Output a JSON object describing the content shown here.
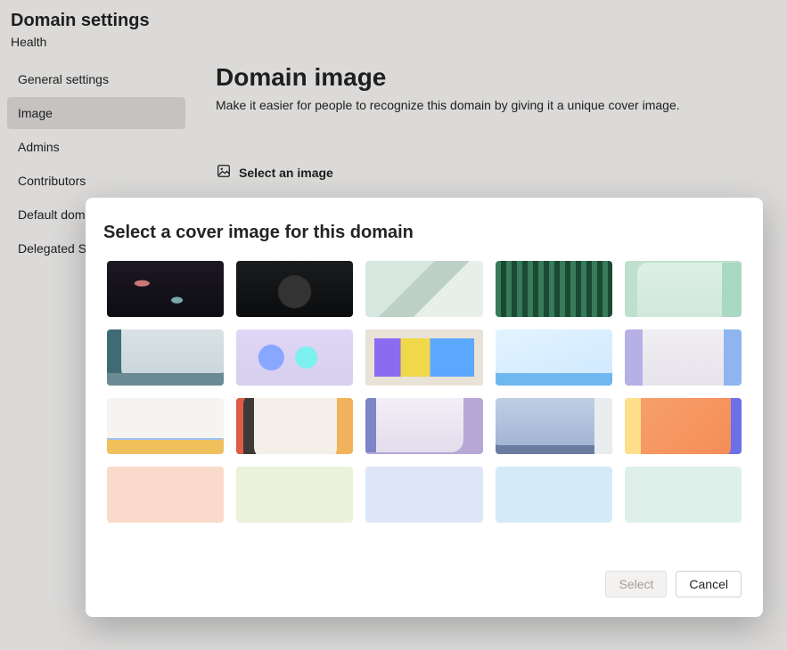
{
  "header": {
    "title": "Domain settings",
    "subtitle": "Health"
  },
  "sidebar": {
    "items": [
      {
        "label": "General settings"
      },
      {
        "label": "Image"
      },
      {
        "label": "Admins"
      },
      {
        "label": "Contributors"
      },
      {
        "label": "Default domain"
      },
      {
        "label": "Delegated Settings"
      }
    ],
    "active_index": 1
  },
  "content": {
    "title": "Domain image",
    "description": "Make it easier for people to recognize this domain by giving it a unique cover image.",
    "select_image_label": "Select an image"
  },
  "dialog": {
    "title": "Select a cover image for this domain",
    "thumbnails": [
      {
        "kind": "image",
        "name": "code-editor-dark"
      },
      {
        "kind": "image",
        "name": "device-dark"
      },
      {
        "kind": "image",
        "name": "abstract-green-tiles"
      },
      {
        "kind": "image",
        "name": "spreadsheet-dark"
      },
      {
        "kind": "image",
        "name": "notebook-mint"
      },
      {
        "kind": "image",
        "name": "teal-cubes"
      },
      {
        "kind": "image",
        "name": "glass-cubes"
      },
      {
        "kind": "image",
        "name": "phone-apps"
      },
      {
        "kind": "image",
        "name": "card-stack-blue"
      },
      {
        "kind": "image",
        "name": "abstract-lavender-shapes"
      },
      {
        "kind": "image",
        "name": "paper-stack-colors"
      },
      {
        "kind": "image",
        "name": "desk-monitor"
      },
      {
        "kind": "image",
        "name": "laptop-pastel"
      },
      {
        "kind": "image",
        "name": "abstract-landscape"
      },
      {
        "kind": "image",
        "name": "orange-render"
      },
      {
        "kind": "swatch",
        "color": "#fadacb"
      },
      {
        "kind": "swatch",
        "color": "#eaf2da"
      },
      {
        "kind": "swatch",
        "color": "#dde5f9"
      },
      {
        "kind": "swatch",
        "color": "#d5eaf7"
      },
      {
        "kind": "swatch",
        "color": "#def0e9"
      }
    ],
    "buttons": {
      "select": "Select",
      "cancel": "Cancel"
    }
  }
}
